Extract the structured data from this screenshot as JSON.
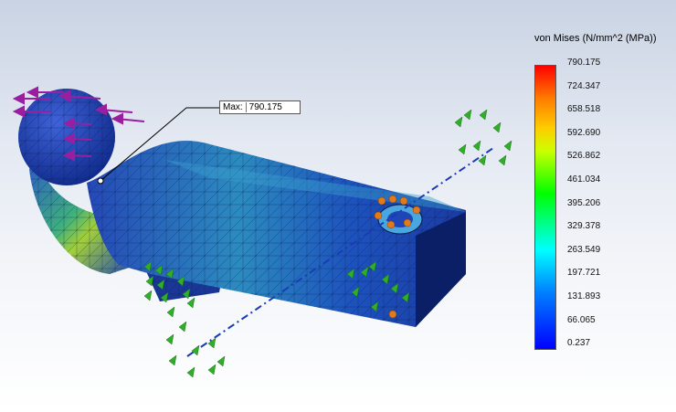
{
  "legend": {
    "title": "von Mises (N/mm^2 (MPa))",
    "ticks": [
      "790.175",
      "724.347",
      "658.518",
      "592.690",
      "526.862",
      "461.034",
      "395.206",
      "329.378",
      "263.549",
      "197.721",
      "131.893",
      "66.065",
      "0.237"
    ]
  },
  "callout": {
    "label": "Max:",
    "value": "790.175"
  },
  "colors": {
    "part_base": "#1d3fa8",
    "mesh": "#0a1a4a",
    "load_arrow": "#9a1fa0",
    "fixture_arrow": "#2fae2a",
    "bolt_arrow": "#e07a1a"
  }
}
